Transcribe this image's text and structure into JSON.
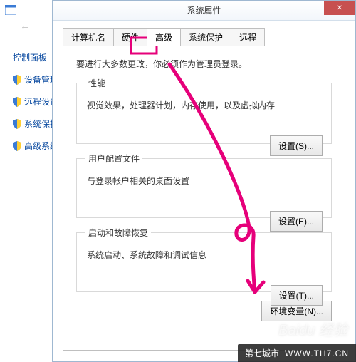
{
  "back_window": {
    "control_panel": "控制面板",
    "side_links": [
      "设备管理",
      "远程设置",
      "系统保护",
      "高级系统"
    ]
  },
  "dialog": {
    "title": "系统属性",
    "tabs": [
      "计算机名",
      "硬件",
      "高级",
      "系统保护",
      "远程"
    ],
    "active_tab": 2,
    "intro": "要进行大多数更改，你必须作为管理员登录。",
    "sections": {
      "perf": {
        "legend": "性能",
        "desc": "视觉效果，处理器计划，内存使用，以及虚拟内存",
        "button": "设置(S)..."
      },
      "profile": {
        "legend": "用户配置文件",
        "desc": "与登录帐户相关的桌面设置",
        "button": "设置(E)..."
      },
      "startup": {
        "legend": "启动和故障恢复",
        "desc": "系统启动、系统故障和调试信息",
        "button": "设置(T)..."
      }
    },
    "env_button": "环境变量(N)..."
  },
  "watermark": {
    "baidu": "Baidu 经验",
    "site_cn": "第七城市",
    "site_url": "WWW.TH7.CN"
  },
  "annotation": {
    "color": "#e6007a"
  }
}
